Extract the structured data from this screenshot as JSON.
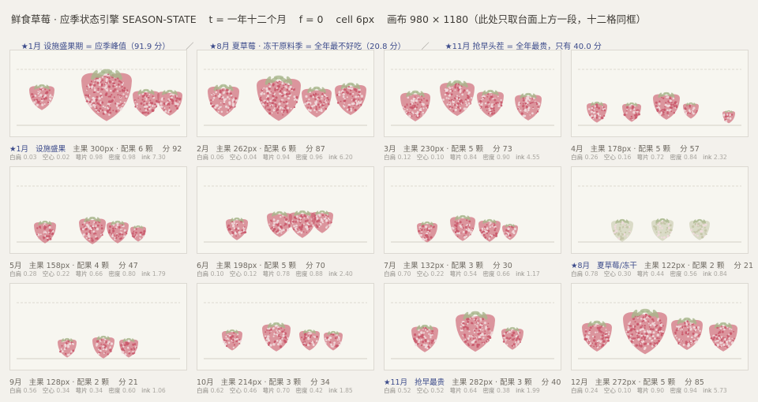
{
  "header": {
    "title": "鲜食草莓 · 应季状态引擎 SEASON-STATE    t = 一年十二个月    f = 0    cell 6px    画布 980 × 1180（此处只取台面上方一段，十二格同框）",
    "notes": [
      "★1月 设施盛果期 = 应季峰值（91.9 分）",
      "★8月 夏草莓 · 冻干原料季 = 全年最不好吃（20.8 分）",
      "★11月 抢早头茬 = 全年最贵，只有 40.0 分"
    ]
  },
  "colors": {
    "berry": "#c9596b",
    "leaf": "#a8b78c",
    "pale": "#c3c4a6",
    "seed": "#efdadd"
  },
  "cells": [
    {
      "month": "1月",
      "star": true,
      "tag": "设施盛果",
      "main": "主果 300px",
      "side": "配果 6 颗",
      "score": "分 92",
      "stats": {
        "white": "0.03",
        "hollow": "0.02",
        "stem": "0.98",
        "density": "0.98",
        "ink": "7.30"
      },
      "berries": [
        [
          40,
          59,
          16
        ],
        [
          122,
          56,
          32
        ],
        [
          172,
          66,
          17
        ],
        [
          202,
          66,
          16
        ]
      ]
    },
    {
      "month": "2月",
      "star": false,
      "tag": "",
      "main": "主果 262px",
      "side": "配果 6 颗",
      "score": "分 87",
      "stats": {
        "white": "0.06",
        "hollow": "0.04",
        "stem": "0.94",
        "density": "0.96",
        "ink": "6.20"
      },
      "berries": [
        [
          33,
          63,
          20
        ],
        [
          103,
          60,
          28
        ],
        [
          151,
          65,
          19
        ],
        [
          194,
          61,
          20
        ]
      ]
    },
    {
      "month": "3月",
      "star": false,
      "tag": "",
      "main": "主果 230px",
      "side": "配果 5 颗",
      "score": "分 73",
      "stats": {
        "white": "0.12",
        "hollow": "0.10",
        "stem": "0.84",
        "density": "0.90",
        "ink": "4.55"
      },
      "berries": [
        [
          39,
          70,
          19
        ],
        [
          92,
          60,
          22
        ],
        [
          134,
          67,
          17
        ],
        [
          182,
          71,
          17
        ]
      ]
    },
    {
      "month": "4月",
      "star": false,
      "tag": "",
      "main": "主果 178px",
      "side": "配果 5 颗",
      "score": "分 57",
      "stats": {
        "white": "0.26",
        "hollow": "0.16",
        "stem": "0.72",
        "density": "0.84",
        "ink": "2.32"
      },
      "berries": [
        [
          32,
          78,
          13
        ],
        [
          76,
          78,
          12
        ],
        [
          120,
          70,
          17
        ],
        [
          151,
          76,
          10
        ],
        [
          199,
          84,
          8
        ]
      ]
    },
    {
      "month": "5月",
      "star": false,
      "tag": "",
      "main": "主果 158px",
      "side": "配果 4 颗",
      "score": "分 47",
      "stats": {
        "white": "0.28",
        "hollow": "0.22",
        "stem": "0.66",
        "density": "0.80",
        "ink": "1.79"
      },
      "berries": [
        [
          44,
          82,
          14
        ],
        [
          104,
          80,
          17
        ],
        [
          136,
          82,
          14
        ],
        [
          162,
          84,
          10
        ]
      ]
    },
    {
      "month": "6月",
      "star": false,
      "tag": "",
      "main": "主果 198px",
      "side": "配果 5 颗",
      "score": "分 70",
      "stats": {
        "white": "0.10",
        "hollow": "0.12",
        "stem": "0.78",
        "density": "0.88",
        "ink": "2.40"
      },
      "berries": [
        [
          50,
          78,
          14
        ],
        [
          104,
          72,
          16
        ],
        [
          133,
          72,
          17
        ],
        [
          158,
          69,
          14
        ]
      ]
    },
    {
      "month": "7月",
      "star": false,
      "tag": "",
      "main": "主果 132px",
      "side": "配果 3 颗",
      "score": "分 30",
      "stats": {
        "white": "0.70",
        "hollow": "0.22",
        "stem": "0.54",
        "density": "0.66",
        "ink": "1.17"
      },
      "berries": [
        [
          54,
          82,
          13
        ],
        [
          99,
          77,
          16
        ],
        [
          133,
          80,
          14
        ],
        [
          159,
          82,
          10
        ]
      ]
    },
    {
      "month": "8月",
      "star": true,
      "tag": "夏草莓/冻干",
      "main": "主果 122px",
      "side": "配果 2 颗",
      "score": "分 21",
      "stats": {
        "white": "0.78",
        "hollow": "0.30",
        "stem": "0.44",
        "density": "0.56",
        "ink": "0.84"
      },
      "berries": [
        [
          64,
          80,
          14
        ],
        [
          115,
          79,
          14
        ],
        [
          162,
          79,
          13
        ]
      ]
    },
    {
      "month": "9月",
      "star": false,
      "tag": "",
      "main": "主果 128px",
      "side": "配果 2 颗",
      "score": "分 21",
      "stats": {
        "white": "0.56",
        "hollow": "0.34",
        "stem": "0.34",
        "density": "0.60",
        "ink": "1.06"
      },
      "berries": [
        [
          72,
          81,
          12
        ],
        [
          118,
          80,
          14
        ],
        [
          150,
          81,
          12
        ]
      ]
    },
    {
      "month": "10月",
      "star": false,
      "tag": "",
      "main": "主果 214px",
      "side": "配果 3 颗",
      "score": "分 34",
      "stats": {
        "white": "0.62",
        "hollow": "0.46",
        "stem": "0.70",
        "density": "0.42",
        "ink": "1.85"
      },
      "berries": [
        [
          44,
          71,
          13
        ],
        [
          100,
          67,
          18
        ],
        [
          142,
          71,
          13
        ],
        [
          172,
          72,
          12
        ]
      ]
    },
    {
      "month": "11月",
      "star": true,
      "tag": "抢早最贵",
      "main": "主果 282px",
      "side": "配果 3 颗",
      "score": "分 40",
      "stats": {
        "white": "0.52",
        "hollow": "0.52",
        "stem": "0.64",
        "density": "0.38",
        "ink": "1.99"
      },
      "berries": [
        [
          51,
          69,
          17
        ],
        [
          115,
          60,
          25
        ],
        [
          162,
          69,
          14
        ]
      ]
    },
    {
      "month": "12月",
      "star": false,
      "tag": "",
      "main": "主果 272px",
      "side": "配果 5 颗",
      "score": "分 85",
      "stats": {
        "white": "0.24",
        "hollow": "0.10",
        "stem": "0.90",
        "density": "0.94",
        "ink": "5.73"
      },
      "berries": [
        [
          32,
          66,
          19
        ],
        [
          93,
          60,
          28
        ],
        [
          146,
          63,
          20
        ],
        [
          192,
          67,
          18
        ]
      ]
    }
  ],
  "stat_labels": {
    "white": "白肩",
    "hollow": "空心",
    "stem": "萼片",
    "density": "密度",
    "ink": "ink"
  }
}
